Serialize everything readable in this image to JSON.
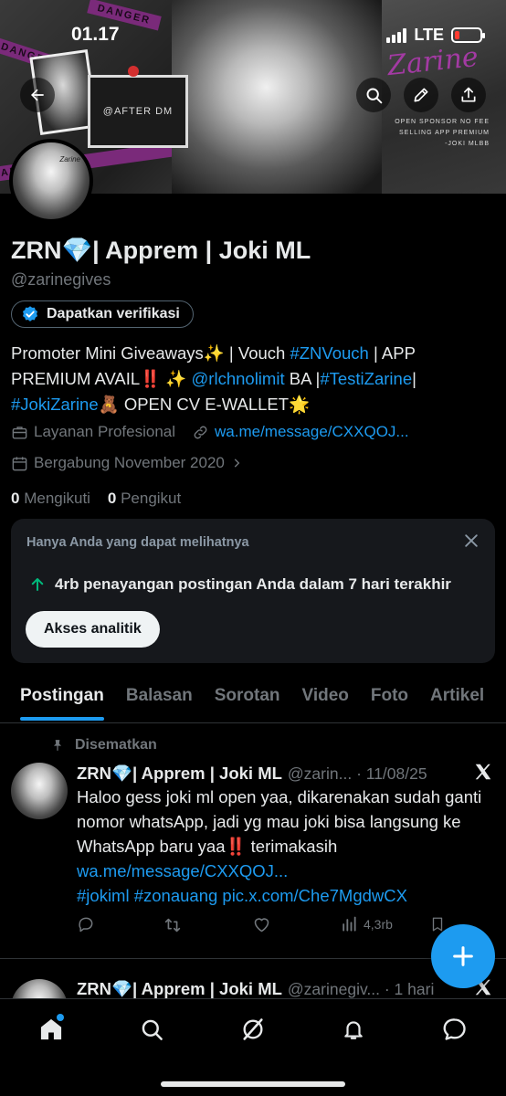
{
  "status_bar": {
    "time": "01.17",
    "network": "LTE"
  },
  "banner": {
    "tape_text": "DANGER",
    "after_dm": "@AFTER DM",
    "brand_word": "Zarine",
    "note_lines": [
      "OPEN SPONSOR NO FEE",
      "SELLING APP PREMIUM",
      "-JOKI MLBB"
    ]
  },
  "header_buttons": {
    "back_icon": "arrow-left-icon",
    "search_icon": "search-icon",
    "edit_icon": "pencil-icon",
    "share_icon": "share-icon"
  },
  "profile": {
    "avatar_tag": "Zarine",
    "name": "ZRN💎| Apprem | Joki ML",
    "handle": "@zarinegives",
    "verify_label": "Dapatkan verifikasi",
    "bio": {
      "t1": "Promoter Mini Giveaways✨ | Vouch ",
      "l1": "#ZNVouch",
      "t2": " | APP PREMIUM AVAIL‼️ ✨ ",
      "l2": "@rlchnolimit",
      "t3": " BA |",
      "l3": "#TestiZarine",
      "t4": "| ",
      "l4": "#JokiZarine",
      "t5": "🧸 OPEN CV E-WALLET🌟"
    },
    "category": "Layanan Profesional",
    "website": "wa.me/message/CXXQOJ...",
    "joined": "Bergabung November 2020",
    "following_count": "0",
    "following_label": "Mengikuti",
    "followers_count": "0",
    "followers_label": "Pengikut"
  },
  "analytics_card": {
    "title": "Hanya Anda yang dapat melihatnya",
    "stat": "4rb penayangan postingan Anda dalam 7 hari terakhir",
    "button": "Akses analitik"
  },
  "tabs": [
    "Postingan",
    "Balasan",
    "Sorotan",
    "Video",
    "Foto",
    "Artikel"
  ],
  "pinned_post": {
    "pinned_label": "Disematkan",
    "name": "ZRN💎| Apprem | Joki ML",
    "meta": "@zarin... · 11/08/25",
    "text": "Haloo gess joki ml open yaa, dikarenakan sudah ganti nomor whatsApp, jadi yg mau joki bisa langsung ke WhatsApp baru yaa‼️  terimakasih",
    "link": "wa.me/message/CXXQOJ...",
    "tags": "#jokiml #zonauang pic.x.com/Che7MgdwCX",
    "views": "4,3rb"
  },
  "second_post": {
    "name": "ZRN💎| Apprem | Joki ML",
    "meta": "@zarinegiv... · 1 hari"
  },
  "bottom_nav": [
    "home-icon",
    "search-icon",
    "grok-icon",
    "notifications-icon",
    "messages-icon"
  ]
}
